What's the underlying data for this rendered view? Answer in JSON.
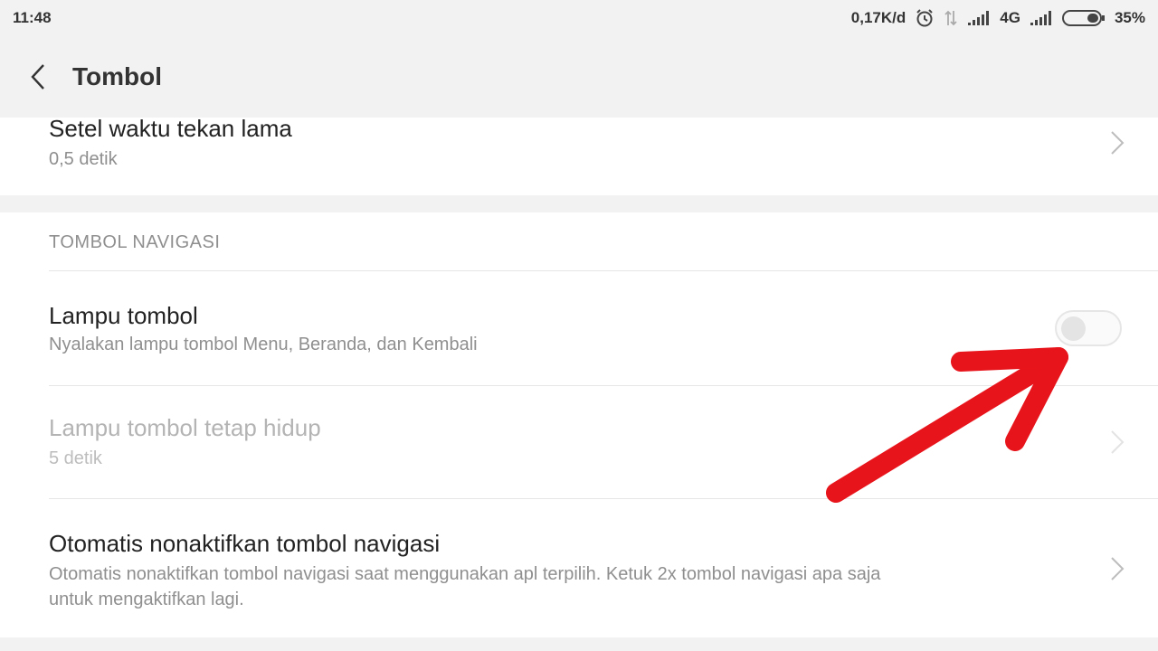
{
  "status_bar": {
    "time": "11:48",
    "net_speed": "0,17K/d",
    "network_type": "4G",
    "battery_percent": "35%",
    "icons": [
      "alarm-icon",
      "data-transfer-icon",
      "signal-icon",
      "signal-icon",
      "battery-icon"
    ]
  },
  "header": {
    "back_icon": "chevron-left-icon",
    "title": "Tombol"
  },
  "settings": {
    "long_press": {
      "title": "Setel waktu tekan lama",
      "value": "0,5 detik"
    },
    "nav_section": {
      "header": "TOMBOL NAVIGASI",
      "items": [
        {
          "title": "Lampu tombol",
          "subtitle": "Nyalakan lampu tombol Menu, Beranda, dan Kembali",
          "control": "toggle",
          "enabled": false
        },
        {
          "title": "Lampu tombol tetap hidup",
          "subtitle": "5 detik",
          "control": "chevron",
          "disabled": true
        },
        {
          "title": "Otomatis nonaktifkan tombol navigasi",
          "subtitle_line1": "Otomatis nonaktifkan tombol navigasi saat menggunakan apl terpilih. Ketuk 2x tombol navigasi apa saja",
          "subtitle_line2": "untuk mengaktifkan lagi.",
          "control": "chevron"
        }
      ]
    }
  },
  "colors": {
    "background": "#f2f2f2",
    "card": "#ffffff",
    "annotation_arrow": "#e8141b"
  }
}
